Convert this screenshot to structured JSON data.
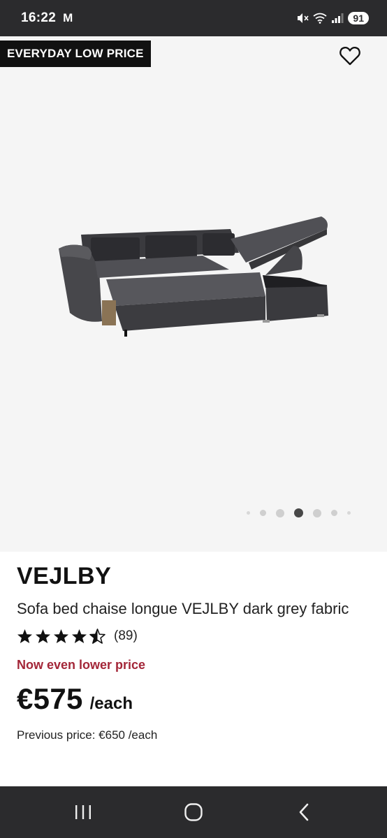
{
  "status_bar": {
    "time": "16:22",
    "mail_icon": "M",
    "battery": "91"
  },
  "gallery": {
    "badge": "EVERYDAY LOW PRICE",
    "image_name": "sofa-bed-image",
    "dots_total": 7,
    "active_dot_index": 3
  },
  "product": {
    "brand": "VEJLBY",
    "description": "Sofa bed chaise longue VEJLBY dark grey fabric",
    "rating": 4.5,
    "rating_count": "(89)",
    "promo": "Now even lower price",
    "price": "€575",
    "unit": "/each",
    "previous_price": "Previous price: €650 /each"
  },
  "nav": {
    "recents_icon": "recents-icon",
    "home_icon": "home-icon",
    "back_icon": "back-icon"
  },
  "colors": {
    "promo": "#a32638",
    "status_bar_bg": "#2b2b2d",
    "gallery_bg": "#f5f5f5"
  }
}
